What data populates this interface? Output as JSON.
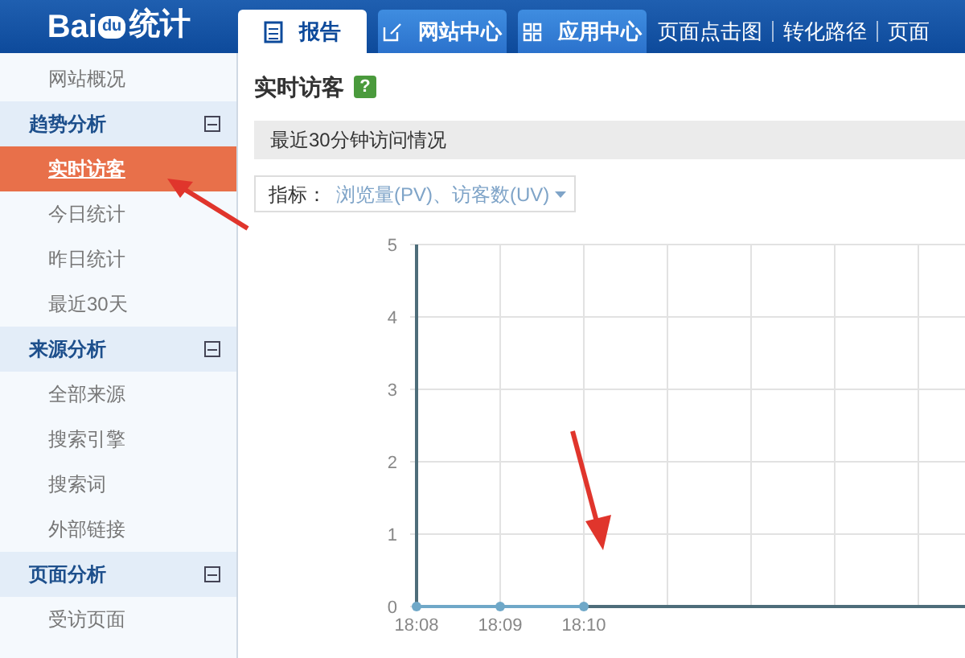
{
  "header": {
    "logo_left": "Bai",
    "logo_paw": "du",
    "logo_right": "统计",
    "tabs": [
      {
        "label": "报告",
        "kind": "list",
        "selected": true
      },
      {
        "label": "网站中心",
        "kind": "edit",
        "selected": false
      },
      {
        "label": "应用中心",
        "kind": "grid",
        "selected": false
      }
    ],
    "links": [
      "页面点击图",
      "转化路径",
      "页面"
    ]
  },
  "sidebar": {
    "items": [
      {
        "kind": "item",
        "label": "网站概况",
        "selected": false
      },
      {
        "kind": "group",
        "label": "趋势分析",
        "expanded": true,
        "children": [
          {
            "label": "实时访客",
            "selected": true
          },
          {
            "label": "今日统计",
            "selected": false
          },
          {
            "label": "昨日统计",
            "selected": false
          },
          {
            "label": "最近30天",
            "selected": false
          }
        ]
      },
      {
        "kind": "group",
        "label": "来源分析",
        "expanded": true,
        "children": [
          {
            "label": "全部来源",
            "selected": false
          },
          {
            "label": "搜索引擎",
            "selected": false
          },
          {
            "label": "搜索词",
            "selected": false
          },
          {
            "label": "外部链接",
            "selected": false
          }
        ]
      },
      {
        "kind": "group",
        "label": "页面分析",
        "expanded": true,
        "children": [
          {
            "label": "受访页面",
            "selected": false
          }
        ]
      }
    ]
  },
  "content": {
    "title": "实时访客",
    "help": "?",
    "section": "最近30分钟访问情况",
    "metric_label": "指标：",
    "metric_value": "浏览量(PV)、访客数(UV)",
    "chart_data": {
      "type": "line",
      "categories": [
        "18:08",
        "18:09",
        "18:10"
      ],
      "grid": true,
      "series": [
        {
          "color": "#6fa8c8",
          "marker": true,
          "values": [
            0,
            0,
            0
          ]
        }
      ],
      "ylim": [
        0,
        5
      ],
      "yticks": [
        0,
        1,
        2,
        3,
        4,
        5
      ]
    }
  }
}
